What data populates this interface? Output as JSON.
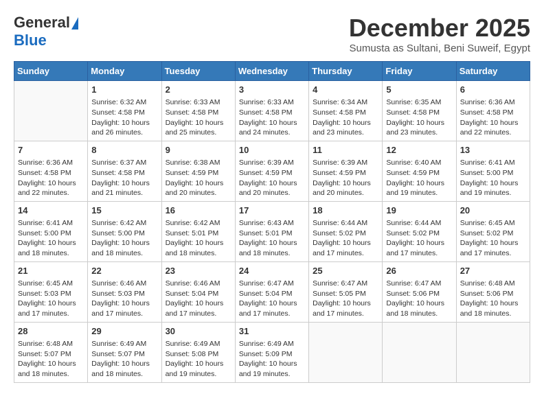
{
  "header": {
    "logo": {
      "general": "General",
      "blue": "Blue",
      "tagline": ""
    },
    "title": "December 2025",
    "subtitle": "Sumusta as Sultani, Beni Suweif, Egypt"
  },
  "weekdays": [
    "Sunday",
    "Monday",
    "Tuesday",
    "Wednesday",
    "Thursday",
    "Friday",
    "Saturday"
  ],
  "weeks": [
    [
      {
        "day": "",
        "info": ""
      },
      {
        "day": "1",
        "info": "Sunrise: 6:32 AM\nSunset: 4:58 PM\nDaylight: 10 hours\nand 26 minutes."
      },
      {
        "day": "2",
        "info": "Sunrise: 6:33 AM\nSunset: 4:58 PM\nDaylight: 10 hours\nand 25 minutes."
      },
      {
        "day": "3",
        "info": "Sunrise: 6:33 AM\nSunset: 4:58 PM\nDaylight: 10 hours\nand 24 minutes."
      },
      {
        "day": "4",
        "info": "Sunrise: 6:34 AM\nSunset: 4:58 PM\nDaylight: 10 hours\nand 23 minutes."
      },
      {
        "day": "5",
        "info": "Sunrise: 6:35 AM\nSunset: 4:58 PM\nDaylight: 10 hours\nand 23 minutes."
      },
      {
        "day": "6",
        "info": "Sunrise: 6:36 AM\nSunset: 4:58 PM\nDaylight: 10 hours\nand 22 minutes."
      }
    ],
    [
      {
        "day": "7",
        "info": "Sunrise: 6:36 AM\nSunset: 4:58 PM\nDaylight: 10 hours\nand 22 minutes."
      },
      {
        "day": "8",
        "info": "Sunrise: 6:37 AM\nSunset: 4:58 PM\nDaylight: 10 hours\nand 21 minutes."
      },
      {
        "day": "9",
        "info": "Sunrise: 6:38 AM\nSunset: 4:59 PM\nDaylight: 10 hours\nand 20 minutes."
      },
      {
        "day": "10",
        "info": "Sunrise: 6:39 AM\nSunset: 4:59 PM\nDaylight: 10 hours\nand 20 minutes."
      },
      {
        "day": "11",
        "info": "Sunrise: 6:39 AM\nSunset: 4:59 PM\nDaylight: 10 hours\nand 20 minutes."
      },
      {
        "day": "12",
        "info": "Sunrise: 6:40 AM\nSunset: 4:59 PM\nDaylight: 10 hours\nand 19 minutes."
      },
      {
        "day": "13",
        "info": "Sunrise: 6:41 AM\nSunset: 5:00 PM\nDaylight: 10 hours\nand 19 minutes."
      }
    ],
    [
      {
        "day": "14",
        "info": "Sunrise: 6:41 AM\nSunset: 5:00 PM\nDaylight: 10 hours\nand 18 minutes."
      },
      {
        "day": "15",
        "info": "Sunrise: 6:42 AM\nSunset: 5:00 PM\nDaylight: 10 hours\nand 18 minutes."
      },
      {
        "day": "16",
        "info": "Sunrise: 6:42 AM\nSunset: 5:01 PM\nDaylight: 10 hours\nand 18 minutes."
      },
      {
        "day": "17",
        "info": "Sunrise: 6:43 AM\nSunset: 5:01 PM\nDaylight: 10 hours\nand 18 minutes."
      },
      {
        "day": "18",
        "info": "Sunrise: 6:44 AM\nSunset: 5:02 PM\nDaylight: 10 hours\nand 17 minutes."
      },
      {
        "day": "19",
        "info": "Sunrise: 6:44 AM\nSunset: 5:02 PM\nDaylight: 10 hours\nand 17 minutes."
      },
      {
        "day": "20",
        "info": "Sunrise: 6:45 AM\nSunset: 5:02 PM\nDaylight: 10 hours\nand 17 minutes."
      }
    ],
    [
      {
        "day": "21",
        "info": "Sunrise: 6:45 AM\nSunset: 5:03 PM\nDaylight: 10 hours\nand 17 minutes."
      },
      {
        "day": "22",
        "info": "Sunrise: 6:46 AM\nSunset: 5:03 PM\nDaylight: 10 hours\nand 17 minutes."
      },
      {
        "day": "23",
        "info": "Sunrise: 6:46 AM\nSunset: 5:04 PM\nDaylight: 10 hours\nand 17 minutes."
      },
      {
        "day": "24",
        "info": "Sunrise: 6:47 AM\nSunset: 5:04 PM\nDaylight: 10 hours\nand 17 minutes."
      },
      {
        "day": "25",
        "info": "Sunrise: 6:47 AM\nSunset: 5:05 PM\nDaylight: 10 hours\nand 17 minutes."
      },
      {
        "day": "26",
        "info": "Sunrise: 6:47 AM\nSunset: 5:06 PM\nDaylight: 10 hours\nand 18 minutes."
      },
      {
        "day": "27",
        "info": "Sunrise: 6:48 AM\nSunset: 5:06 PM\nDaylight: 10 hours\nand 18 minutes."
      }
    ],
    [
      {
        "day": "28",
        "info": "Sunrise: 6:48 AM\nSunset: 5:07 PM\nDaylight: 10 hours\nand 18 minutes."
      },
      {
        "day": "29",
        "info": "Sunrise: 6:49 AM\nSunset: 5:07 PM\nDaylight: 10 hours\nand 18 minutes."
      },
      {
        "day": "30",
        "info": "Sunrise: 6:49 AM\nSunset: 5:08 PM\nDaylight: 10 hours\nand 19 minutes."
      },
      {
        "day": "31",
        "info": "Sunrise: 6:49 AM\nSunset: 5:09 PM\nDaylight: 10 hours\nand 19 minutes."
      },
      {
        "day": "",
        "info": ""
      },
      {
        "day": "",
        "info": ""
      },
      {
        "day": "",
        "info": ""
      }
    ]
  ]
}
